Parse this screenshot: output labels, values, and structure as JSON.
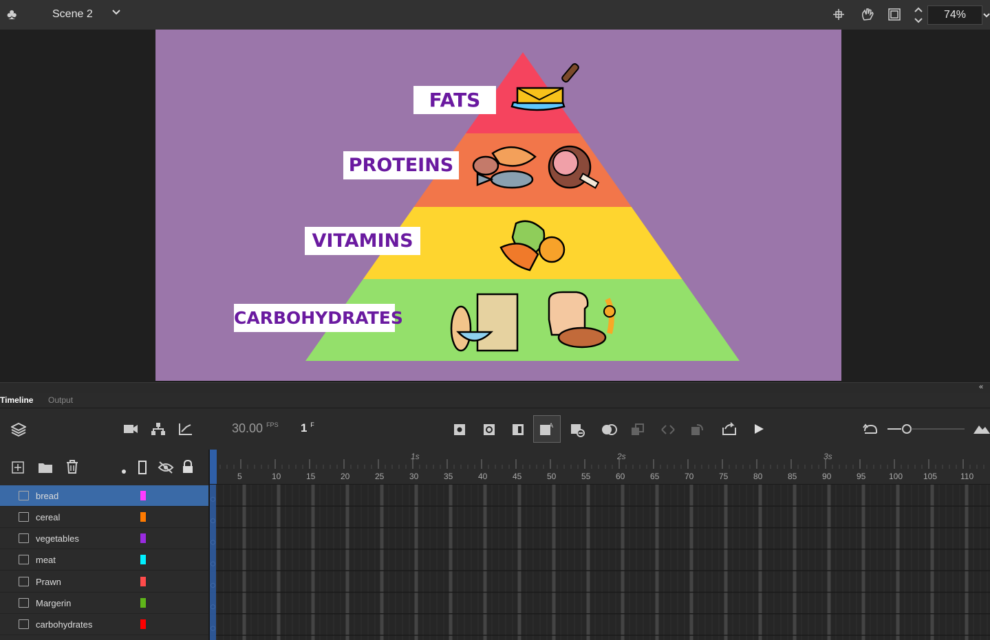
{
  "header": {
    "scene_name": "Scene 2",
    "zoom": "74%"
  },
  "stage": {
    "pyramid_colors": [
      "#f5445e",
      "#f2764a",
      "#fed52f",
      "#94e06b"
    ],
    "labels": {
      "fats": "FATS",
      "proteins": "PROTEINS",
      "vitamins": "VITAMINS",
      "carbohydrates": "CARBOHYDRATES"
    }
  },
  "panel": {
    "tabs": {
      "timeline": "Timeline",
      "output": "Output"
    },
    "fps_value": "30.00",
    "fps_unit": "FPS",
    "current_frame": "1",
    "frame_unit": "F"
  },
  "ruler": {
    "seconds": [
      "1s",
      "2s",
      "3s"
    ],
    "ticks": [
      "5",
      "10",
      "15",
      "20",
      "25",
      "30",
      "35",
      "40",
      "45",
      "50",
      "55",
      "60",
      "65",
      "70",
      "75",
      "80",
      "85",
      "90",
      "95",
      "100",
      "105",
      "110"
    ]
  },
  "layers": [
    {
      "name": "bread",
      "color": "#ff3bff",
      "selected": true
    },
    {
      "name": "cereal",
      "color": "#ff7a00",
      "selected": false
    },
    {
      "name": "vegetables",
      "color": "#9a2be0",
      "selected": false
    },
    {
      "name": "meat",
      "color": "#00f0ff",
      "selected": false
    },
    {
      "name": "Prawn",
      "color": "#ff4b4b",
      "selected": false
    },
    {
      "name": "Margerin",
      "color": "#5fb51a",
      "selected": false
    },
    {
      "name": "carbohydrates",
      "color": "#ff0000",
      "selected": false
    }
  ]
}
